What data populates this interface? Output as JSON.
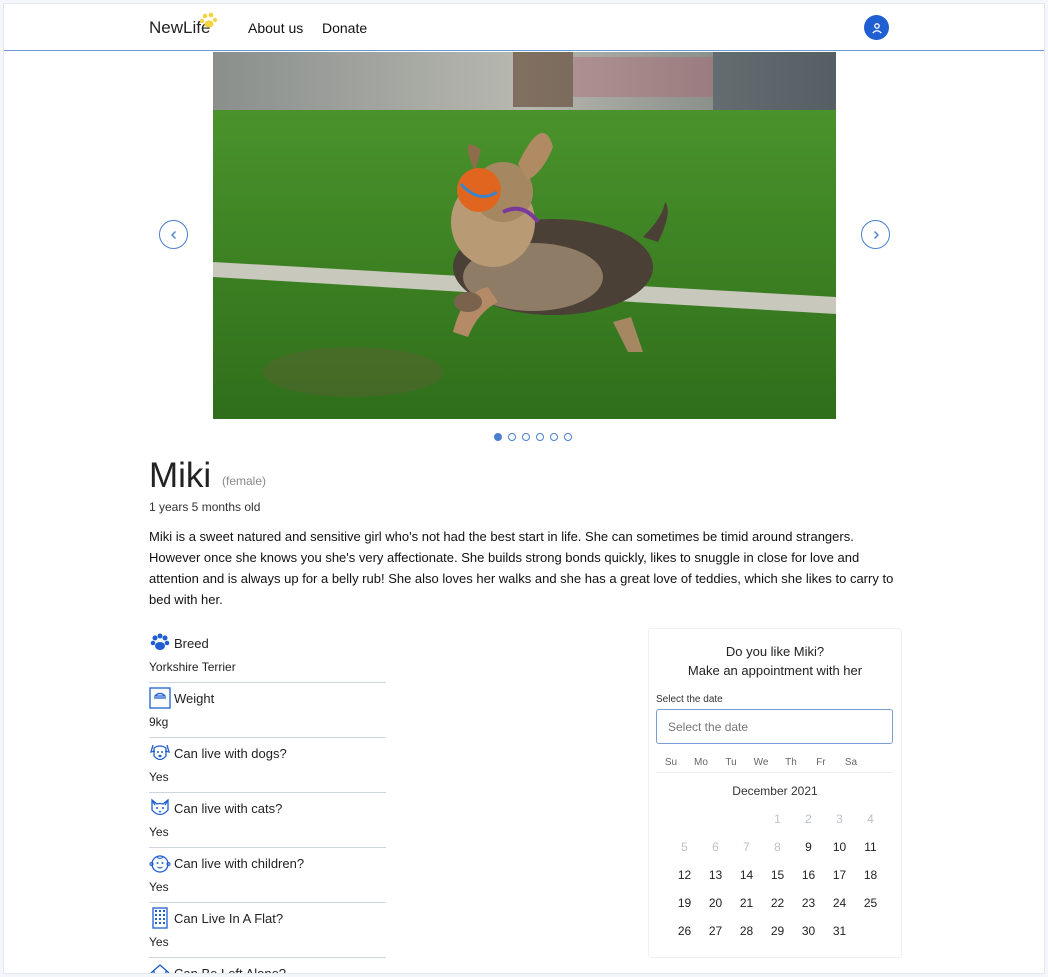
{
  "header": {
    "logo": "NewLife",
    "nav": {
      "about": "About us",
      "donate": "Donate"
    },
    "user_icon": "user-icon"
  },
  "carousel": {
    "prev_icon": "chevron-left-icon",
    "next_icon": "chevron-right-icon",
    "photo": "dog-photo",
    "slide_count": 6,
    "active_slide": 1
  },
  "pet": {
    "name": "Miki",
    "gender": "(female)",
    "age": "1 years 5 months old",
    "description": "Miki is a sweet natured and sensitive girl who's not had the best start in life. She can sometimes be timid around strangers. However once she knows you she's very affectionate. She builds strong bonds quickly, likes to snuggle in close for love and attention and is always up for a belly rub! She also loves her walks and she has a great love of teddies, which she likes to carry to bed with her."
  },
  "attributes": [
    {
      "icon": "paw-icon",
      "label": "Breed",
      "value": "Yorkshire Terrier"
    },
    {
      "icon": "scale-icon",
      "label": "Weight",
      "value": "9kg"
    },
    {
      "icon": "dog-face-icon",
      "label": "Can live with dogs?",
      "value": "Yes"
    },
    {
      "icon": "cat-face-icon",
      "label": "Can live with cats?",
      "value": "Yes"
    },
    {
      "icon": "child-face-icon",
      "label": "Can live with children?",
      "value": "Yes"
    },
    {
      "icon": "building-icon",
      "label": "Can Live In A Flat?",
      "value": "Yes"
    },
    {
      "icon": "house-icon",
      "label": "Can Be Left Alone?",
      "value": ""
    }
  ],
  "appointment": {
    "question": "Do you like Miki?",
    "prompt": "Make an appointment with her",
    "field_label": "Select the date",
    "placeholder": "Select the date",
    "weekdays": [
      "Su",
      "Mo",
      "Tu",
      "We",
      "Th",
      "Fr",
      "Sa"
    ],
    "month": "December 2021",
    "days": [
      [
        "",
        "",
        "",
        "1",
        "2",
        "3",
        "4"
      ],
      [
        "5",
        "6",
        "7",
        "8",
        "9",
        "10",
        "11"
      ],
      [
        "12",
        "13",
        "14",
        "15",
        "16",
        "17",
        "18"
      ],
      [
        "19",
        "20",
        "21",
        "22",
        "23",
        "24",
        "25"
      ],
      [
        "26",
        "27",
        "28",
        "29",
        "30",
        "31",
        ""
      ]
    ],
    "disabled_days": [
      "1",
      "2",
      "3",
      "4",
      "5",
      "6",
      "7",
      "8"
    ]
  }
}
